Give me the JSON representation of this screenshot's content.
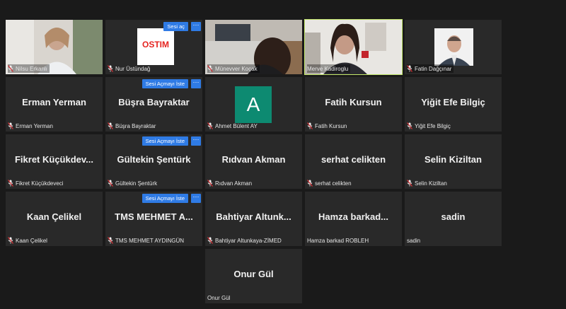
{
  "tiles": [
    {
      "name": "Nilsu Erkanlı",
      "display": "",
      "muted": true,
      "type": "video"
    },
    {
      "name": "Nur Üstündağ",
      "display": "",
      "muted": true,
      "type": "logo",
      "logo_text": "OSTIM",
      "tag": "Sesi aç"
    },
    {
      "name": "Münevver Koçak",
      "display": "",
      "muted": true,
      "type": "video"
    },
    {
      "name": "Merve Kadiroglu",
      "display": "",
      "muted": false,
      "type": "video",
      "speaking": true
    },
    {
      "name": "Fatin Dağçınar",
      "display": "",
      "muted": true,
      "type": "video"
    },
    {
      "name": "Erman Yerman",
      "display": "Erman Yerman",
      "muted": true
    },
    {
      "name": "Büşra Bayraktar",
      "display": "Büşra Bayraktar",
      "muted": true,
      "tag": "Sesi Açmayı İste"
    },
    {
      "name": "Ahmet Bülent AY",
      "display": "",
      "muted": true,
      "type": "avatar",
      "initial": "A"
    },
    {
      "name": "Fatih Kursun",
      "display": "Fatih Kursun",
      "muted": true
    },
    {
      "name": "Yiğit Efe Bilgiç",
      "display": "Yiğit Efe Bilgiç",
      "muted": true
    },
    {
      "name": "Fikret Küçükdeveci",
      "display": "Fikret Küçükdev...",
      "muted": true
    },
    {
      "name": "Gültekin Şentürk",
      "display": "Gültekin Şentürk",
      "muted": true,
      "tag": "Sesi Açmayı İste"
    },
    {
      "name": "Rıdvan Akman",
      "display": "Rıdvan Akman",
      "muted": true
    },
    {
      "name": "serhat celikten",
      "display": "serhat celikten",
      "muted": true
    },
    {
      "name": "Selin Kiziltan",
      "display": "Selin Kiziltan",
      "muted": true
    },
    {
      "name": "Kaan Çelikel",
      "display": "Kaan Çelikel",
      "muted": true
    },
    {
      "name": "TMS MEHMET AYDINGÜN",
      "display": "TMS MEHMET A...",
      "muted": true,
      "tag": "Sesi Açmayı İste"
    },
    {
      "name": "Bahtiyar Altunkaya-ZİMED",
      "display": "Bahtiyar Altunk...",
      "muted": true
    },
    {
      "name": "Hamza barkad ROBLEH",
      "display": "Hamza barkad...",
      "muted": false
    },
    {
      "name": "sadin",
      "display": "sadin",
      "muted": false
    },
    {
      "name": "Onur Gül",
      "display": "Onur Gül",
      "muted": false
    }
  ],
  "more_glyph": "···",
  "colors": {
    "tile": "#292929",
    "bg": "#1a1a1a",
    "accent": "#2f7be5",
    "speaking": "#c4e86b",
    "mute": "#d13438"
  }
}
